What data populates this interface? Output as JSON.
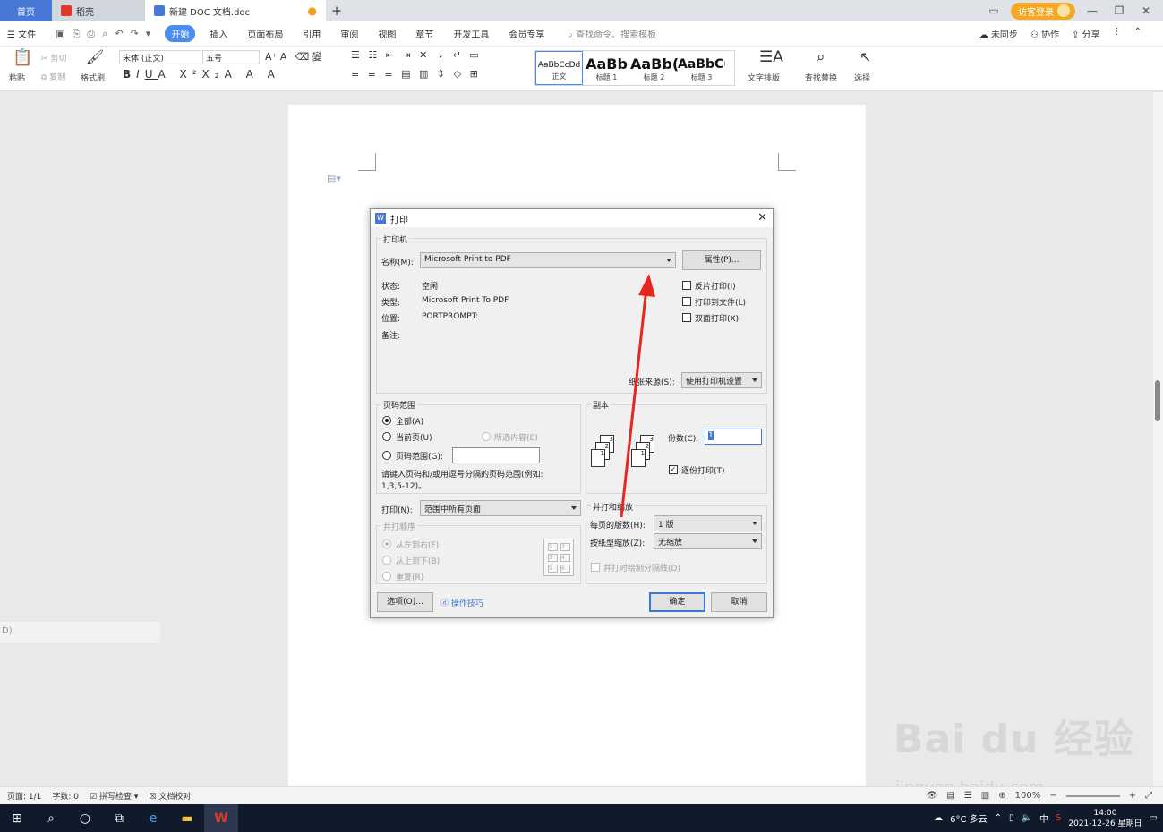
{
  "titlebar": {
    "tab_home": "首页",
    "tab_daoke": "稻壳",
    "tab_doc": "新建 DOC 文档.doc",
    "guest_login": "访客登录"
  },
  "menubar": {
    "file": "文件",
    "tabs": [
      "开始",
      "插入",
      "页面布局",
      "引用",
      "审阅",
      "视图",
      "章节",
      "开发工具",
      "会员专享"
    ],
    "search_placeholder": "查找命令、搜索模板",
    "sync": "未同步",
    "collab": "协作",
    "share": "分享"
  },
  "ribbon": {
    "paste": "粘贴",
    "cut": "剪切",
    "copy": "复制",
    "format_painter": "格式刷",
    "font_name": "宋体 (正文)",
    "font_size": "五号",
    "styles": [
      {
        "sample": "AaBbCcDd",
        "name": "正文"
      },
      {
        "sample": "AaBb",
        "name": "标题 1"
      },
      {
        "sample": "AaBb(",
        "name": "标题 2"
      },
      {
        "sample": "AaBbC(",
        "name": "标题 3"
      }
    ],
    "text_layout": "文字排版",
    "find_replace": "查找替换",
    "select": "选择"
  },
  "leftpanel": {
    "text": "D)"
  },
  "dialog": {
    "title": "打印",
    "printer_group": "打印机",
    "name_label": "名称(M):",
    "printer_name": "Microsoft Print to PDF",
    "properties_button": "属性(P)...",
    "status_label": "状态:",
    "status_value": "空闲",
    "type_label": "类型:",
    "type_value": "Microsoft Print To PDF",
    "location_label": "位置:",
    "location_value": "PORTPROMPT:",
    "comment_label": "备注:",
    "reverse_print": "反片打印(I)",
    "print_to_file": "打印到文件(L)",
    "duplex_print": "双面打印(X)",
    "paper_source_label": "纸张来源(S):",
    "paper_source_value": "使用打印机设置",
    "range_group": "页码范围",
    "range_all": "全部(A)",
    "range_current": "当前页(U)",
    "range_selection": "所选内容(E)",
    "range_pages": "页码范围(G):",
    "range_hint": "请键入页码和/或用逗号分隔的页码范围(例如:",
    "range_hint_example": "1,3,5-12)。",
    "copies_group": "副本",
    "copies_label": "份数(C):",
    "copies_value": "1",
    "collate": "逐份打印(T)",
    "print_label": "打印(N):",
    "print_value": "范围中所有页面",
    "order_group": "并打顺序",
    "order_ltr": "从左到右(F)",
    "order_ttb": "从上到下(B)",
    "order_repeat": "重复(R)",
    "zoom_group": "并打和缩放",
    "pages_per_sheet_label": "每页的版数(H):",
    "pages_per_sheet_value": "1 版",
    "scale_label": "按纸型缩放(Z):",
    "scale_value": "无缩放",
    "draw_lines": "并打时绘制分隔线(D)",
    "options_button": "选项(O)...",
    "tips_link": "操作技巧",
    "ok_button": "确定",
    "cancel_button": "取消"
  },
  "statusbar": {
    "page": "页面: 1/1",
    "words": "字数: 0",
    "spell": "拼写检查",
    "proof": "文档校对",
    "zoom": "100%"
  },
  "taskbar": {
    "weather": "6°C 多云",
    "ime": "中",
    "time": "14:00",
    "date": "2021-12-26 星期日"
  },
  "watermark": {
    "brand": "Bai du 经验",
    "url": "jingyan.baidu.com"
  },
  "colors": {
    "accent": "#4a8cf0",
    "arrow": "#e8261e",
    "guest": "#f5a623"
  }
}
